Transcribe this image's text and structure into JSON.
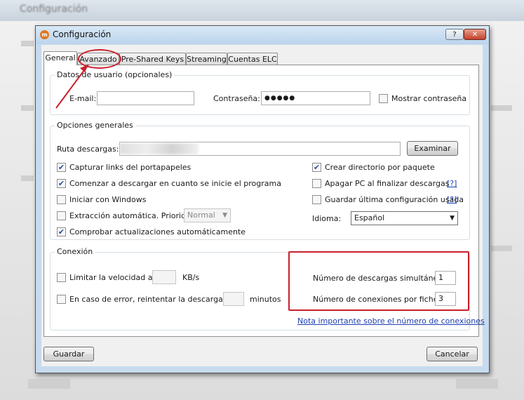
{
  "window": {
    "title": "Configuración",
    "help_glyph": "?",
    "close_glyph": "✕",
    "background_title": "Configuración"
  },
  "tabs": [
    "General",
    "Avanzado",
    "Pre-Shared Keys",
    "Streaming",
    "Cuentas ELC"
  ],
  "user_group": {
    "legend": "Datos de usuario (opcionales)",
    "email_label": "E-mail:",
    "email_value": "",
    "password_label": "Contraseña:",
    "password_value": "●●●●●",
    "show_password_label": "Mostrar contraseña",
    "show_password_checked": false
  },
  "general_group": {
    "legend": "Opciones generales",
    "path_label": "Ruta descargas:",
    "browse_label": "Examinar",
    "left_options": [
      {
        "label": "Capturar links del portapapeles",
        "checked": true
      },
      {
        "label": "Comenzar a descargar en cuanto se inicie el programa",
        "checked": true
      },
      {
        "label": "Iniciar con Windows",
        "checked": false
      },
      {
        "label": "Extracción automática. Prioridad:",
        "checked": false
      },
      {
        "label": "Comprobar actualizaciones automáticamente",
        "checked": true
      }
    ],
    "priority_value": "Normal",
    "right_options": [
      {
        "label": "Crear directorio por paquete",
        "checked": true
      },
      {
        "label": "Apagar PC al finalizar descargas",
        "checked": false,
        "help": "[?]"
      },
      {
        "label": "Guardar última configuración usada",
        "checked": false,
        "help": "[?]"
      }
    ],
    "language_label": "Idioma:",
    "language_value": "Español"
  },
  "connection_group": {
    "legend": "Conexión",
    "limit_label": "Limitar la velocidad a",
    "limit_value": "",
    "limit_unit": "KB/s",
    "retry_label": "En caso de error, reintentar la descarga cada",
    "retry_value": "",
    "retry_unit": "minutos",
    "simultaneous_label": "Número de descargas simultáneas:",
    "simultaneous_value": "1",
    "connections_label": "Número de conexiones por fichero:",
    "connections_value": "3",
    "note_link": "Nota importante sobre el número de conexiones"
  },
  "footer": {
    "save_label": "Guardar",
    "cancel_label": "Cancelar"
  },
  "colors": {
    "annotation": "#c8202c",
    "link": "#1c3fb0",
    "check": "#2a4ea0"
  }
}
